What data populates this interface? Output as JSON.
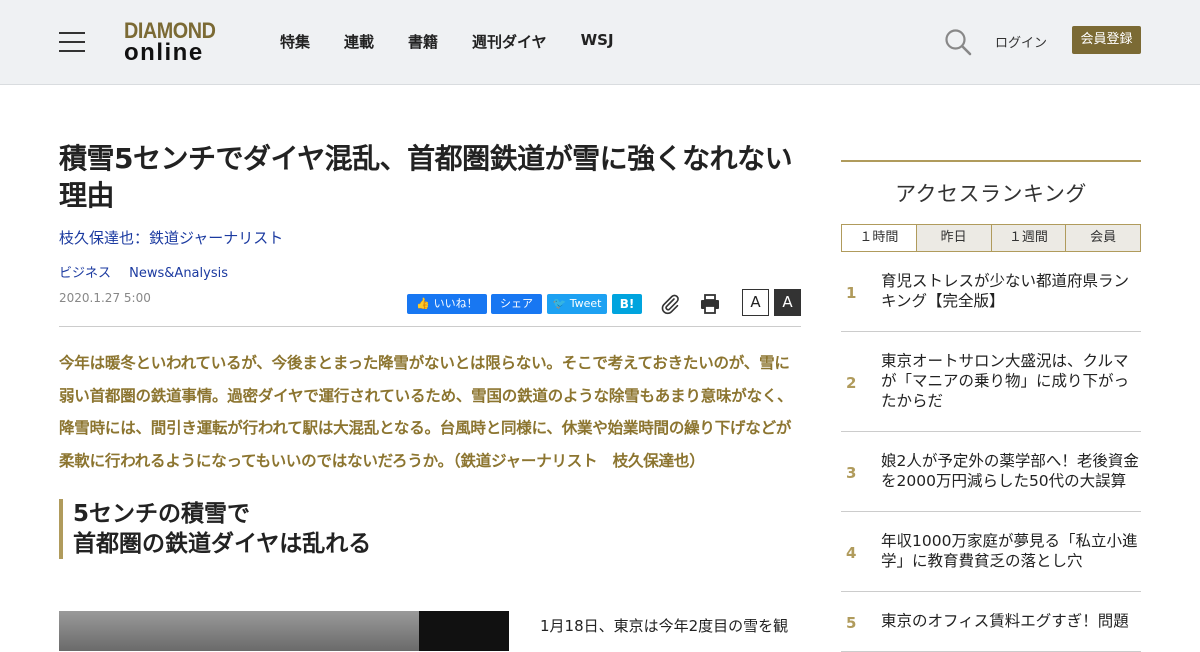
{
  "header": {
    "logo_line1": "DIAMOND",
    "logo_line2": "online",
    "nav": [
      "特集",
      "連載",
      "書籍",
      "週刊ダイヤ",
      "WSJ"
    ],
    "login": "ログイン",
    "register": "会員登録",
    "icons": [
      "menu-icon",
      "search-icon"
    ]
  },
  "article": {
    "title": "積雪5センチでダイヤ混乱、首都圏鉄道が雪に強くなれない理由",
    "author": "枝久保達也：鉄道ジャーナリスト",
    "tags": [
      "ビジネス",
      "News&Analysis"
    ],
    "date": "2020.1.27 5:00",
    "share": {
      "like": "👍 いいね！",
      "share": "シェア",
      "tweet": "🐦 Tweet",
      "hatena": "B!",
      "font_small": "A",
      "font_large": "A"
    },
    "lead": "今年は暖冬といわれているが、今後まとまった降雪がないとは限らない。そこで考えておきたいのが、雪に弱い首都圏の鉄道事情。過密ダイヤで運行されているため、雪国の鉄道のような除雪もあまり意味がなく、降雪時には、間引き運転が行われて駅は大混乱となる。台風時と同様に、休業や始業時間の繰り下げなどが柔軟に行われるようになってもいいのではないだろうか。（鉄道ジャーナリスト　枝久保達也）",
    "subhead_line1": "5センチの積雪で",
    "subhead_line2": "首都圏の鉄道ダイヤは乱れる",
    "body_start": "1月18日、東京は今年2度目の雪を観"
  },
  "sidebar": {
    "ranking_title": "アクセスランキング",
    "tabs": [
      "１時間",
      "昨日",
      "１週間",
      "会員"
    ],
    "items": [
      {
        "num": "1",
        "text": "育児ストレスが少ない都道府県ランキング【完全版】"
      },
      {
        "num": "2",
        "text": "東京オートサロン大盛況は、クルマが「マニアの乗り物」に成り下がったからだ"
      },
      {
        "num": "3",
        "text": "娘2人が予定外の薬学部へ！老後資金を2000万円減らした50代の大誤算"
      },
      {
        "num": "4",
        "text": "年収1000万家庭が夢見る「私立小進学」に教育費貧乏の落とし穴"
      },
      {
        "num": "5",
        "text": "東京のオフィス賃料エグすぎ！問題"
      }
    ]
  }
}
